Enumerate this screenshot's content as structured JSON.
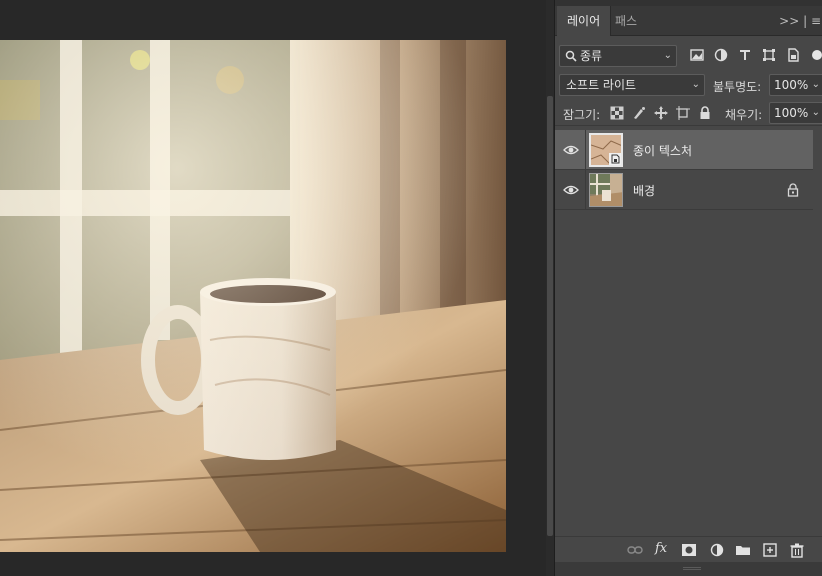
{
  "canvas": {
    "image_description_icon": "coffee-mug-photo"
  },
  "panel": {
    "tabs": [
      {
        "label": "레이어",
        "active": true
      },
      {
        "label": "패스",
        "active": false
      }
    ],
    "tab_bar_right": ">> | ≡",
    "filter": {
      "kind_label": "종류",
      "icons": [
        "image-filter-icon",
        "adjustment-filter-icon",
        "type-filter-icon",
        "shape-filter-icon",
        "smart-object-filter-icon"
      ]
    },
    "blend_mode": "소프트 라이트",
    "opacity_label": "불투명도:",
    "opacity_value": "100%",
    "lock_label": "잠그기:",
    "fill_label": "채우기:",
    "fill_value": "100%",
    "layers": [
      {
        "name": "종이 텍스처",
        "selected": true,
        "visible": true,
        "locked": false,
        "smart_object": true
      },
      {
        "name": "배경",
        "selected": false,
        "visible": true,
        "locked": true,
        "smart_object": false
      }
    ],
    "bottom_icons": [
      "link-layers-icon",
      "fx-icon",
      "add-mask-icon",
      "adjustment-layer-icon",
      "group-folder-icon",
      "new-layer-icon",
      "delete-layer-icon"
    ],
    "fx_label": "fx"
  },
  "colors": {
    "panel_bg": "#474747",
    "selected_row": "#626262",
    "app_bg": "#282828"
  }
}
